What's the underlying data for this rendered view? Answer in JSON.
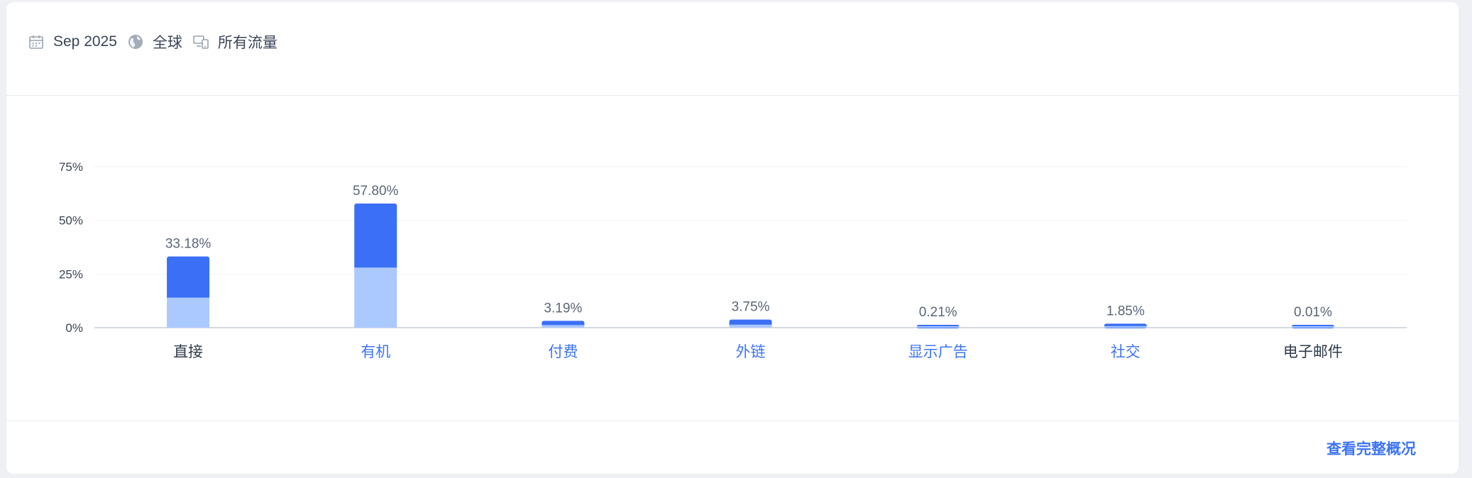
{
  "filters": {
    "date": "Sep 2025",
    "region": "全球",
    "traffic": "所有流量"
  },
  "chart_data": {
    "type": "bar",
    "stacked": true,
    "categories": [
      "直接",
      "有机",
      "付费",
      "外链",
      "显示广告",
      "社交",
      "电子邮件"
    ],
    "values": [
      33.18,
      57.8,
      3.19,
      3.75,
      0.21,
      1.85,
      0.01
    ],
    "value_labels": [
      "33.18%",
      "57.80%",
      "3.19%",
      "3.75%",
      "0.21%",
      "1.85%",
      "0.01%"
    ],
    "series": [
      {
        "values": [
          14.0,
          28.0,
          1.2,
          1.4,
          0.21,
          0.7,
          0.01
        ]
      },
      {
        "values": [
          19.18,
          29.8,
          1.99,
          2.35,
          0.0,
          1.15,
          0.0
        ]
      }
    ],
    "category_colors": [
      "#2f3a4c",
      "#3d74f5",
      "#3d74f5",
      "#3d74f5",
      "#3d74f5",
      "#3d74f5",
      "#2f3a4c"
    ],
    "y_ticks": [
      "0%",
      "25%",
      "50%",
      "75%"
    ],
    "ylim": [
      0,
      75
    ],
    "colors": {
      "dark": "#3b6ff5",
      "light": "#abc9ff"
    },
    "grid": true
  },
  "footer": {
    "link": "查看完整概况"
  }
}
